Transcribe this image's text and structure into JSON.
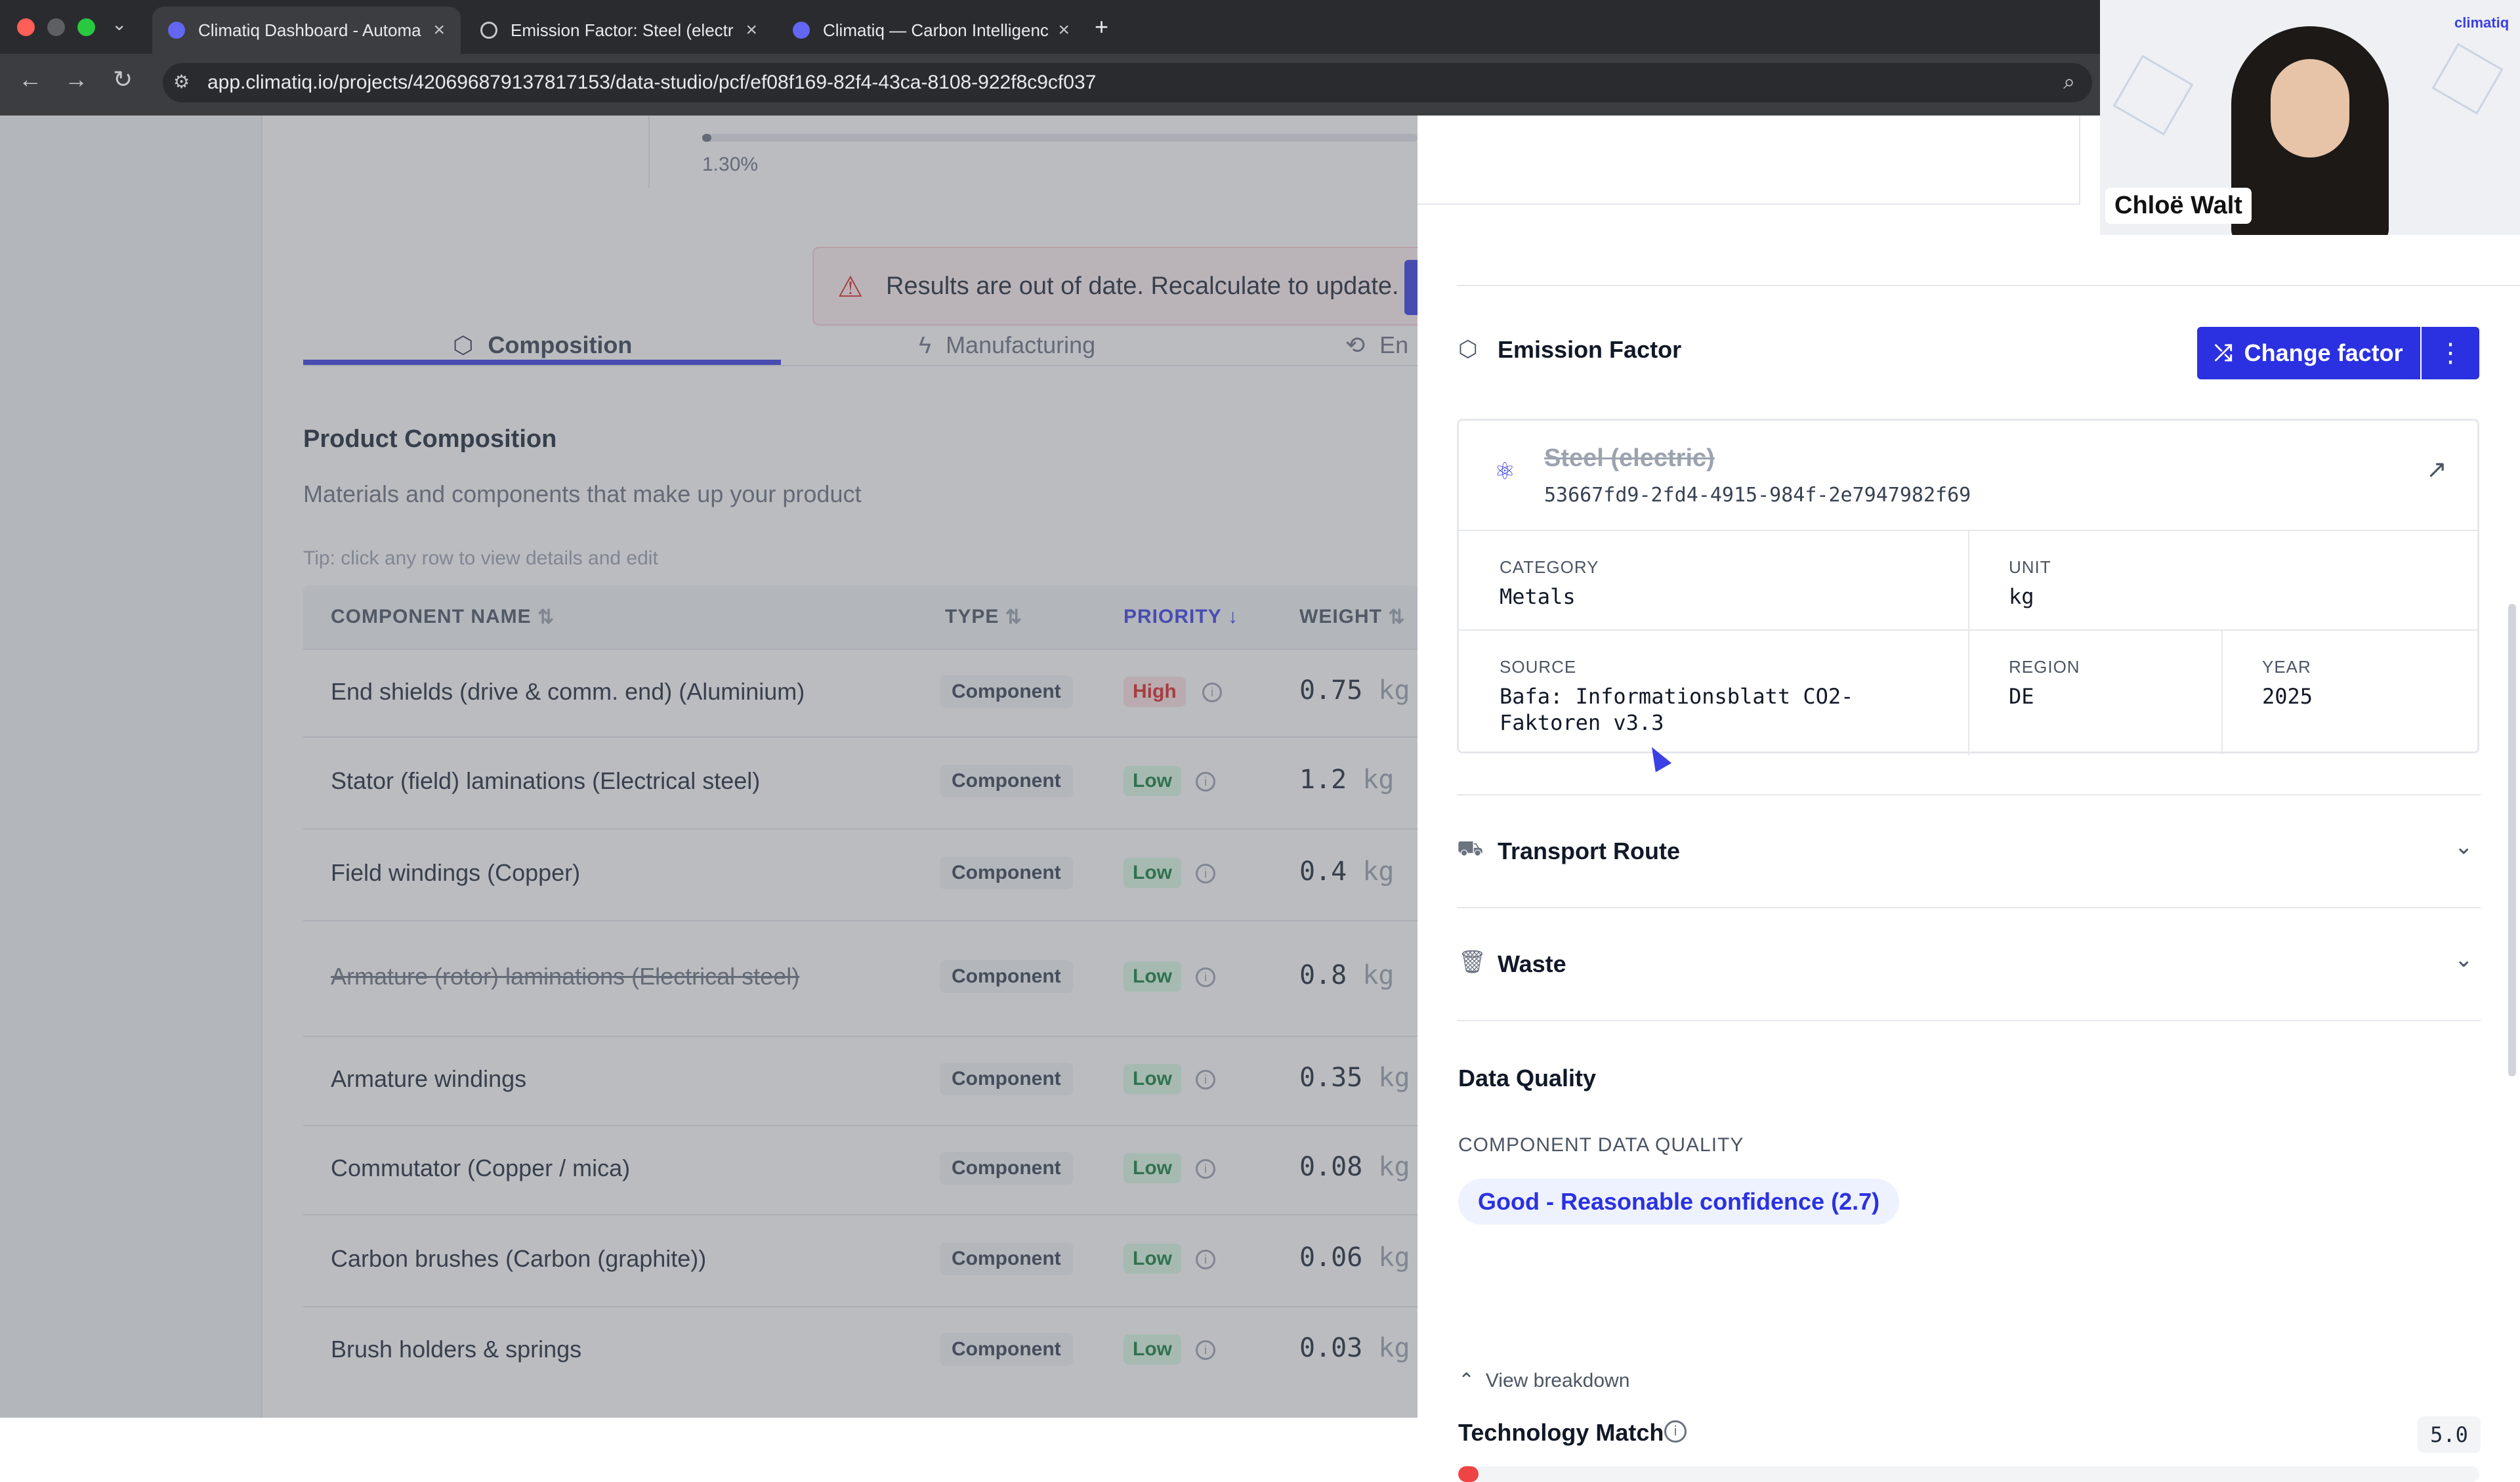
{
  "browser": {
    "tabs": [
      {
        "title": "Climatiq Dashboard - Automa",
        "active": true
      },
      {
        "title": "Emission Factor: Steel (electr",
        "active": false
      },
      {
        "title": "Climatiq — Carbon Intelligenc",
        "active": false
      }
    ],
    "new_tab": "+",
    "close": "×",
    "url": "app.climatiq.io/projects/420696879137817153/data-studio/pcf/ef08f169-82f4-43ca-8108-922f8c9cf037",
    "nav": {
      "back": "←",
      "forward": "→",
      "reload": "↻",
      "zoom": "⌕"
    }
  },
  "summary": {
    "percent": "1.30%",
    "progress_fraction": 0.013
  },
  "banner": {
    "text": "Results are out of date. Recalculate to update.",
    "icon": "warning-icon"
  },
  "tabs": [
    {
      "label": "Composition",
      "icon": "cube-icon"
    },
    {
      "label": "Manufacturing",
      "icon": "bolt-icon"
    },
    {
      "label": "En",
      "icon": "cycle-icon"
    }
  ],
  "composition": {
    "title": "Product Composition",
    "subtitle": "Materials and components that make up your product",
    "tip": "Tip: click any row to view details and edit",
    "columns": {
      "name": "COMPONENT NAME",
      "type": "TYPE",
      "priority": "PRIORITY",
      "weight": "WEIGHT"
    },
    "sort_icons": {
      "unsorted": "⇅",
      "desc": "↓"
    },
    "rows": [
      {
        "name": "End shields (drive & comm. end) (Aluminium)",
        "type": "Component",
        "priority": "High",
        "weight": "0.75",
        "unit": "kg",
        "struck": false
      },
      {
        "name": "Stator (field) laminations (Electrical steel)",
        "type": "Component",
        "priority": "Low",
        "weight": "1.2",
        "unit": "kg",
        "struck": false
      },
      {
        "name": "Field windings (Copper)",
        "type": "Component",
        "priority": "Low",
        "weight": "0.4",
        "unit": "kg",
        "struck": false
      },
      {
        "name": "Armature (rotor) laminations (Electrical steel)",
        "type": "Component",
        "priority": "Low",
        "weight": "0.8",
        "unit": "kg",
        "struck": true
      },
      {
        "name": "Armature windings",
        "type": "Component",
        "priority": "Low",
        "weight": "0.35",
        "unit": "kg",
        "struck": false
      },
      {
        "name": "Commutator (Copper / mica)",
        "type": "Component",
        "priority": "Low",
        "weight": "0.08",
        "unit": "kg",
        "struck": false
      },
      {
        "name": "Carbon brushes (Carbon (graphite))",
        "type": "Component",
        "priority": "Low",
        "weight": "0.06",
        "unit": "kg",
        "struck": false
      },
      {
        "name": "Brush holders & springs",
        "type": "Component",
        "priority": "Low",
        "weight": "0.03",
        "unit": "kg",
        "struck": false
      }
    ]
  },
  "panel": {
    "emission_factor": {
      "title": "Emission Factor",
      "change_label": "Change factor",
      "more_label": "⋮",
      "name": "Steel (electric)",
      "id": "53667fd9-2fd4-4915-984f-2e7947982f69",
      "category_label": "CATEGORY",
      "category": "Metals",
      "unit_label": "UNIT",
      "unit": "kg",
      "source_label": "SOURCE",
      "source": "Bafa: Informationsblatt CO2-Faktoren v3.3",
      "region_label": "REGION",
      "region": "DE",
      "year_label": "YEAR",
      "year": "2025"
    },
    "transport": {
      "title": "Transport Route"
    },
    "waste": {
      "title": "Waste"
    },
    "data_quality": {
      "title": "Data Quality",
      "component_label": "COMPONENT DATA QUALITY",
      "badge": "Good - Reasonable confidence (2.7)",
      "breakdown_label": "View breakdown",
      "technology_label": "Technology Match",
      "technology_score": "5.0",
      "technology_fraction": 0.02
    }
  },
  "video": {
    "name": "Chloë Walt",
    "brand": "climatiq"
  },
  "colors": {
    "accent": "#2b31e0",
    "danger": "#ef4444",
    "low": "#15803d",
    "high": "#dc2626"
  }
}
